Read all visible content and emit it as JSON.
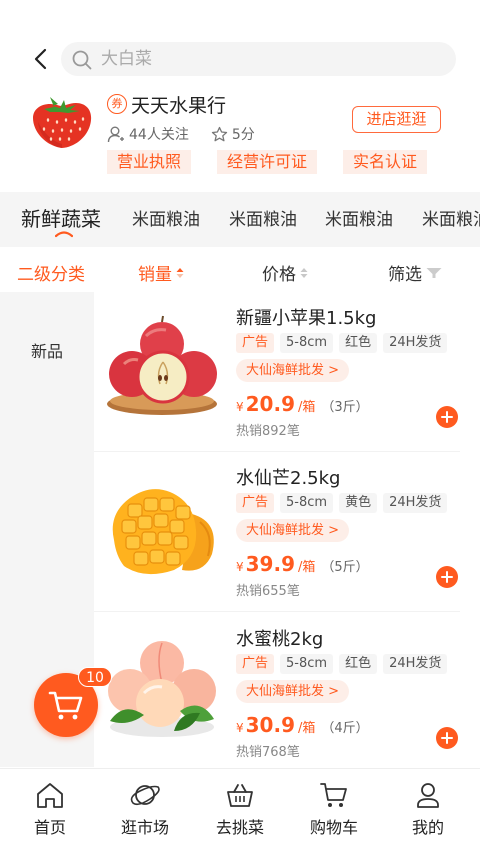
{
  "search": {
    "placeholder": "大白菜"
  },
  "shop": {
    "coupon_badge": "券",
    "name": "天天水果行",
    "followers": "44人关注",
    "rating": "5分",
    "visit_label": "进店逛逛",
    "certificates": [
      "营业执照",
      "经营许可证",
      "实名认证"
    ]
  },
  "categories": [
    "新鲜蔬菜",
    "米面粮油",
    "米面粮油",
    "米面粮油",
    "米面粮油"
  ],
  "sort": {
    "secondary": "二级分类",
    "sales": "销量",
    "price": "价格",
    "filter": "筛选"
  },
  "side_menu": {
    "items": [
      "新品"
    ]
  },
  "products": [
    {
      "title": "新疆小苹果1.5kg",
      "tags": [
        "广告",
        "5-8cm",
        "红色",
        "24H发货"
      ],
      "seller": "大仙海鲜批发 >",
      "currency": "¥",
      "price": "20.9",
      "unit": "/箱",
      "spec": "（3斤）",
      "sold": "热销892笔"
    },
    {
      "title": "水仙芒2.5kg",
      "tags": [
        "广告",
        "5-8cm",
        "黄色",
        "24H发货"
      ],
      "seller": "大仙海鲜批发 >",
      "currency": "¥",
      "price": "39.9",
      "unit": "/箱",
      "spec": "（5斤）",
      "sold": "热销655笔"
    },
    {
      "title": "水蜜桃2kg",
      "tags": [
        "广告",
        "5-8cm",
        "红色",
        "24H发货"
      ],
      "seller": "大仙海鲜批发 >",
      "currency": "¥",
      "price": "30.9",
      "unit": "/箱",
      "spec": "（4斤）",
      "sold": "热销768笔"
    }
  ],
  "cart": {
    "count": "10"
  },
  "tabbar": [
    "首页",
    "逛市场",
    "去挑菜",
    "购物车",
    "我的"
  ],
  "colors": {
    "accent": "#ff5a1f",
    "accent_light": "#fdeee8",
    "panel_bg": "#f5f5f5"
  }
}
